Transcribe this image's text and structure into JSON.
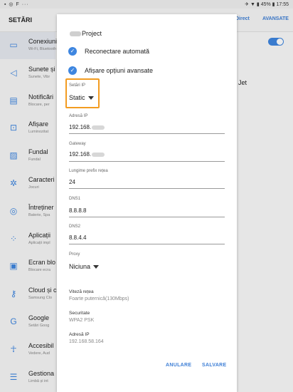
{
  "status_bar": {
    "left_icons": "▪ ◎ F ···",
    "right_text": "✈ ▼ ▮ 45% ▮ 17:55"
  },
  "header": {
    "title": "SETĂRI",
    "wifi_direct": "Direct",
    "advanced_button": "AVANSATE"
  },
  "sidebar": {
    "items": [
      {
        "label": "Conexiuni",
        "sub": "Wi-Fi, Bluetooth",
        "icon": "connections-icon",
        "glyph": "▭",
        "selected": true
      },
      {
        "label": "Sunete și",
        "sub": "Sunete, Vibr",
        "icon": "volume-icon",
        "glyph": "◁",
        "selected": false
      },
      {
        "label": "Notificări",
        "sub": "Blocare, per",
        "icon": "notifications-icon",
        "glyph": "▤",
        "selected": false
      },
      {
        "label": "Afișare",
        "sub": "Luminozitat",
        "icon": "display-icon",
        "glyph": "⊡",
        "selected": false
      },
      {
        "label": "Fundal",
        "sub": "Fundal",
        "icon": "wallpaper-icon",
        "glyph": "▨",
        "selected": false
      },
      {
        "label": "Caracteri",
        "sub": "Jocuri",
        "icon": "advanced-features-icon",
        "glyph": "✲",
        "selected": false
      },
      {
        "label": "Întreținer",
        "sub": "Baterie, Spa",
        "icon": "maintenance-icon",
        "glyph": "◎",
        "selected": false
      },
      {
        "label": "Aplicații",
        "sub": "Aplicații impl",
        "icon": "apps-icon",
        "glyph": "⁘",
        "selected": false
      },
      {
        "label": "Ecran blo",
        "sub": "Blocare ecra",
        "icon": "lock-screen-icon",
        "glyph": "▣",
        "selected": false
      },
      {
        "label": "Cloud și c",
        "sub": "Samsung Clo",
        "icon": "cloud-key-icon",
        "glyph": "⚷",
        "selected": false
      },
      {
        "label": "Google",
        "sub": "Setări Goog",
        "icon": "google-icon",
        "glyph": "G",
        "selected": false
      },
      {
        "label": "Accesibil",
        "sub": "Vedere, Aud",
        "icon": "accessibility-icon",
        "glyph": "☥",
        "selected": false
      },
      {
        "label": "Gestiona",
        "sub": "Limbă și int",
        "icon": "general-management-icon",
        "glyph": "☰",
        "selected": false
      }
    ]
  },
  "right_pane": {
    "jet_text": "Jet"
  },
  "dialog": {
    "title_suffix": "Project",
    "checkbox_auto_reconnect": "Reconectare automată",
    "checkbox_advanced": "Afișare opțiuni avansate",
    "ip_settings_label": "Setări IP",
    "ip_settings_value": "Static",
    "ip_address_label": "Adresă IP",
    "ip_address_value": "192.168.",
    "gateway_label": "Gateway",
    "gateway_value": "192.168.",
    "prefix_label": "Lungime prefix rețea",
    "prefix_value": "24",
    "dns1_label": "DNS1",
    "dns1_value": "8.8.8.8",
    "dns2_label": "DNS2",
    "dns2_value": "8.8.4.4",
    "proxy_label": "Proxy",
    "proxy_value": "Niciuna",
    "speed_label": "Viteză rețea",
    "speed_value": "Foarte puternică(130Mbps)",
    "security_label": "Securitate",
    "security_value": "WPA2 PSK",
    "ip_info_label": "Adresă IP",
    "ip_info_value": "192.168.58.164",
    "cancel": "ANULARE",
    "save": "SALVARE"
  },
  "colors": {
    "accent": "#3e86e0",
    "highlight_box": "#f39c21"
  }
}
